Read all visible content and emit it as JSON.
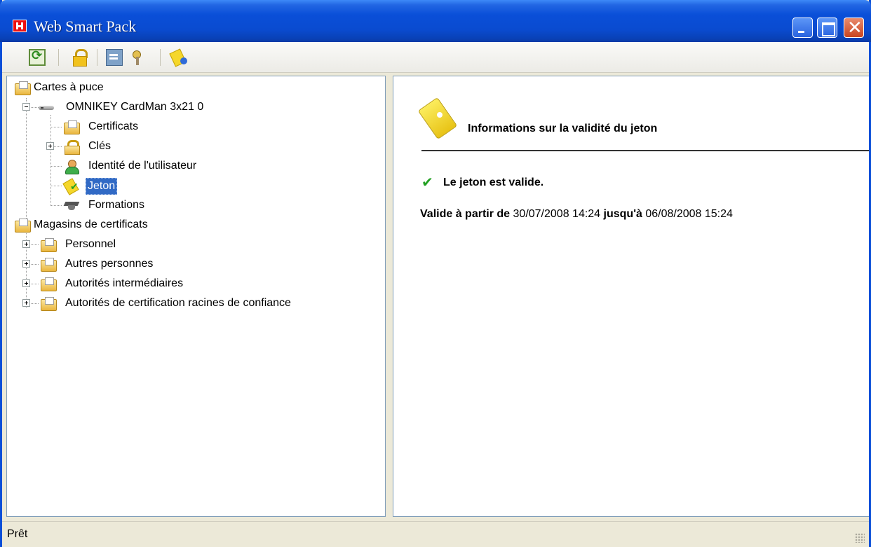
{
  "window": {
    "title": "Web Smart Pack"
  },
  "toolbar": {
    "buttons": [
      {
        "icon": "refresh-icon"
      },
      {
        "icon": "lock-icon"
      },
      {
        "icon": "certificate-icon"
      },
      {
        "icon": "keys-icon"
      },
      {
        "icon": "token-icon"
      }
    ]
  },
  "tree": {
    "root1": "Cartes à puce",
    "reader": "OMNIKEY CardMan 3x21 0",
    "certificats": "Certificats",
    "cles": "Clés",
    "identite": "Identité de l'utilisateur",
    "jeton": "Jeton",
    "formations": "Formations",
    "root2": "Magasins de certificats",
    "personnel": "Personnel",
    "autres": "Autres personnes",
    "intermediaires": "Autorités intermédiaires",
    "racines": "Autorités de certification racines de confiance"
  },
  "details": {
    "title": "Informations sur la validité du jeton",
    "status": "Le jeton est valide.",
    "valid_from_label": "Valide à partir de",
    "valid_from": "30/07/2008 14:24",
    "valid_to_label": "jusqu'à",
    "valid_to": "06/08/2008 15:24"
  },
  "statusbar": {
    "text": "Prêt"
  }
}
